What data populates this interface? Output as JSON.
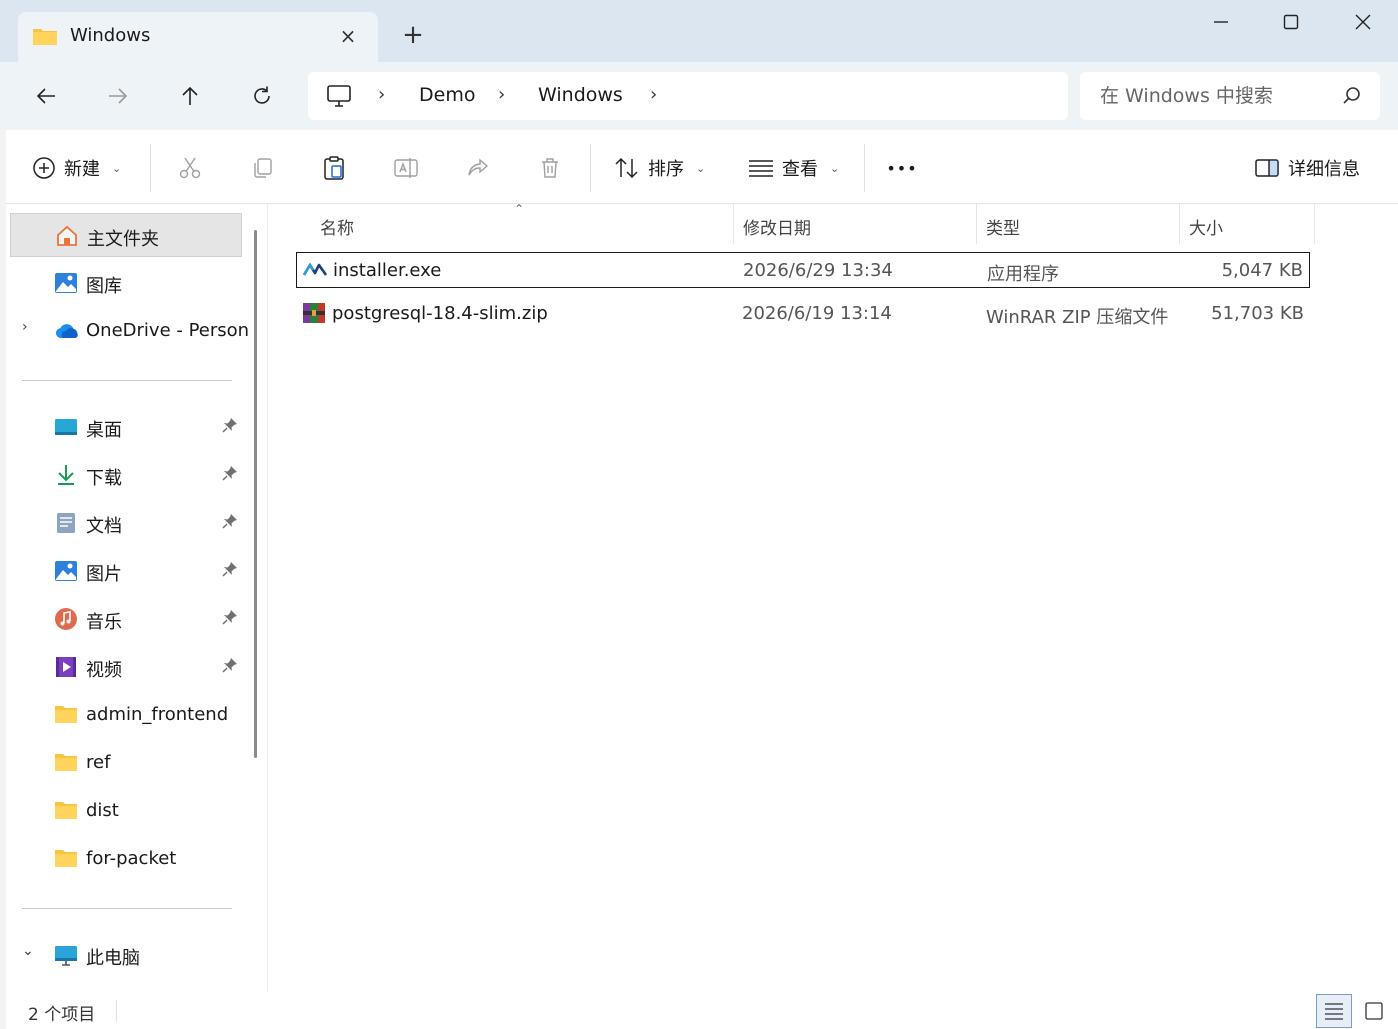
{
  "window": {
    "tab_title": "Windows",
    "tab_close": "×",
    "new_tab": "+"
  },
  "address": {
    "crumbs": [
      "Demo",
      "Windows"
    ],
    "separator": "›"
  },
  "search": {
    "placeholder": "在 Windows 中搜索"
  },
  "commands": {
    "new_label": "新建",
    "sort_label": "排序",
    "view_label": "查看",
    "more_label": "•••",
    "details_label": "详细信息"
  },
  "nav": {
    "home": "主文件夹",
    "gallery": "图库",
    "onedrive": "OneDrive - Person",
    "desktop": "桌面",
    "downloads": "下载",
    "documents": "文档",
    "pictures": "图片",
    "music": "音乐",
    "videos": "视频",
    "folder1": "admin_frontend",
    "folder2": "ref",
    "folder3": "dist",
    "folder4": "for-packet",
    "thispc": "此电脑",
    "expand_closed": "›",
    "expand_open": "⌄"
  },
  "columns": {
    "name": "名称",
    "date": "修改日期",
    "type": "类型",
    "size": "大小"
  },
  "files": [
    {
      "name": "installer.exe",
      "date": "2026/6/29 13:34",
      "type": "应用程序",
      "size": "5,047 KB"
    },
    {
      "name": "postgresql-18.4-slim.zip",
      "date": "2026/6/19 13:14",
      "type": "WinRAR ZIP 压缩文件",
      "size": "51,703 KB"
    }
  ],
  "status": {
    "count": "2 个项目"
  },
  "colors": {
    "titlebar": "#dce6f0",
    "accent": "#1f6fd1",
    "folder": "#f6c342"
  }
}
